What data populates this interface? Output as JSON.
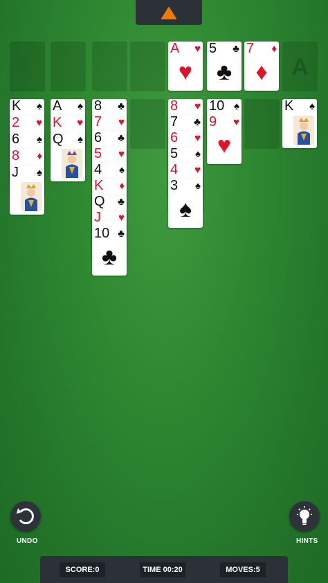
{
  "menu": {
    "icon": "triangle-up-icon",
    "accent": "#f07a00"
  },
  "foundations_empty": [
    1,
    2,
    3,
    4
  ],
  "foundation_cards": [
    {
      "rank": "A",
      "suit": "♥",
      "color": "red"
    },
    {
      "rank": "5",
      "suit": "♣",
      "color": "black"
    },
    {
      "rank": "7",
      "suit": "♦",
      "color": "red"
    }
  ],
  "foundation_placeholder": "A",
  "tableau": [
    [
      {
        "rank": "K",
        "suit": "♠",
        "color": "black"
      },
      {
        "rank": "2",
        "suit": "♥",
        "color": "red"
      },
      {
        "rank": "6",
        "suit": "♠",
        "color": "black"
      },
      {
        "rank": "8",
        "suit": "♦",
        "color": "red"
      },
      {
        "rank": "J",
        "suit": "♠",
        "color": "black",
        "face": "jack"
      }
    ],
    [
      {
        "rank": "A",
        "suit": "♠",
        "color": "black"
      },
      {
        "rank": "K",
        "suit": "♥",
        "color": "red"
      },
      {
        "rank": "Q",
        "suit": "♠",
        "color": "black",
        "face": "queen"
      }
    ],
    [
      {
        "rank": "8",
        "suit": "♣",
        "color": "black"
      },
      {
        "rank": "7",
        "suit": "♥",
        "color": "red"
      },
      {
        "rank": "6",
        "suit": "♣",
        "color": "black"
      },
      {
        "rank": "5",
        "suit": "♥",
        "color": "red"
      },
      {
        "rank": "4",
        "suit": "♠",
        "color": "black"
      },
      {
        "rank": "K",
        "suit": "♦",
        "color": "red"
      },
      {
        "rank": "Q",
        "suit": "♣",
        "color": "black"
      },
      {
        "rank": "J",
        "suit": "♥",
        "color": "red"
      },
      {
        "rank": "10",
        "suit": "♣",
        "color": "black"
      }
    ],
    [],
    [
      {
        "rank": "8",
        "suit": "♥",
        "color": "red"
      },
      {
        "rank": "7",
        "suit": "♣",
        "color": "black"
      },
      {
        "rank": "6",
        "suit": "♥",
        "color": "red"
      },
      {
        "rank": "5",
        "suit": "♠",
        "color": "black"
      },
      {
        "rank": "4",
        "suit": "♥",
        "color": "red"
      },
      {
        "rank": "3",
        "suit": "♠",
        "color": "black"
      }
    ],
    [
      {
        "rank": "10",
        "suit": "♠",
        "color": "black"
      },
      {
        "rank": "9",
        "suit": "♥",
        "color": "red"
      }
    ],
    [],
    [
      {
        "rank": "K",
        "suit": "♠",
        "color": "black",
        "face": "king"
      }
    ]
  ],
  "controls": {
    "undo_label": "UNDO",
    "hints_label": "HINTS",
    "undo_icon": "undo-icon",
    "hints_icon": "lightbulb-icon"
  },
  "status": {
    "score": "SCORE:0",
    "time": "TIME 00:20",
    "moves": "MOVES:5"
  }
}
